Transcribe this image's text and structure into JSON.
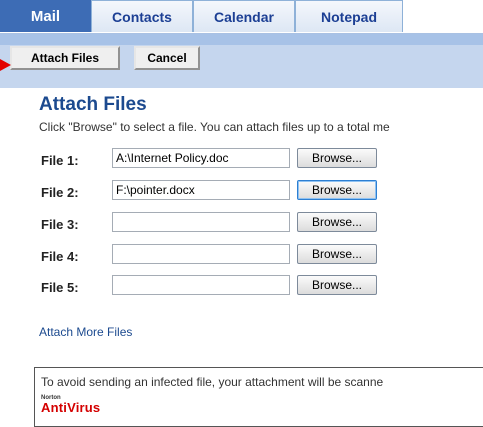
{
  "tabs": [
    "Mail",
    "Contacts",
    "Calendar",
    "Notepad"
  ],
  "toolbar": {
    "attach_label": "Attach Files",
    "cancel_label": "Cancel"
  },
  "page": {
    "title": "Attach Files",
    "description": "Click \"Browse\" to select a file. You can attach files up to a total me"
  },
  "files": [
    {
      "label": "File 1:",
      "value": "A:\\Internet Policy.doc",
      "browse": "Browse..."
    },
    {
      "label": "File 2:",
      "value": "F:\\pointer.docx",
      "browse": "Browse..."
    },
    {
      "label": "File 3:",
      "value": "",
      "browse": "Browse..."
    },
    {
      "label": "File 4:",
      "value": "",
      "browse": "Browse..."
    },
    {
      "label": "File 5:",
      "value": "",
      "browse": "Browse..."
    }
  ],
  "attach_more": "Attach More Files",
  "notice": {
    "text": "To avoid sending an infected file, your attachment will be scanne",
    "logo_small": "Norton",
    "logo_main": "AntiVirus"
  },
  "colors": {
    "accent": "#3d6cb5",
    "toolbar": "#c5d6ee",
    "pointer": "#e30000"
  }
}
